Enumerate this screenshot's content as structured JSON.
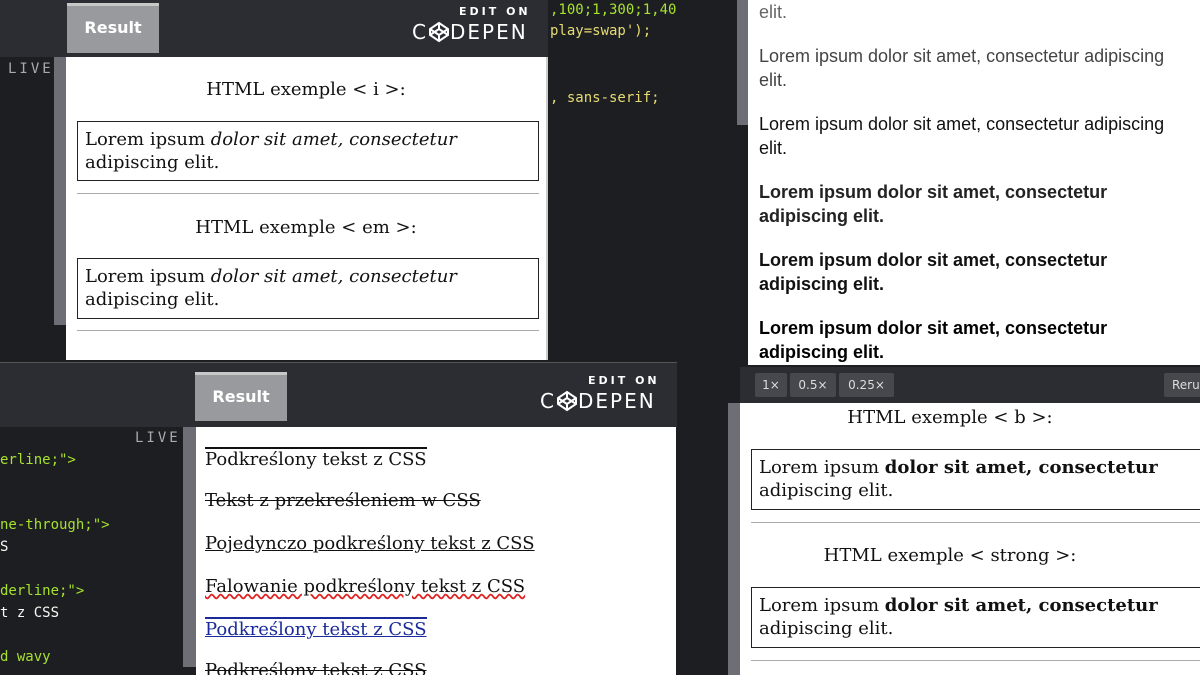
{
  "panel_top_left": {
    "result_tab": "Result",
    "edit_on": "EDIT ON",
    "codepen": "C DEPEN",
    "live": "LIVE",
    "heading_i": "HTML exemple < i >:",
    "box_i": {
      "before": "Lorem ipsum ",
      "emph": "dolor sit amet, consectetur",
      "after": " adipiscing elit."
    },
    "heading_em": "HTML exemple < em >:",
    "box_em": {
      "before": "Lorem ipsum ",
      "emph": "dolor sit amet, consectetur",
      "after": " adipiscing elit."
    }
  },
  "panel_top_middle": {
    "code_line1": ",100;1,300;1,40",
    "code_line2": "play=swap');",
    "code_line3": ", sans-serif;"
  },
  "panel_top_right": {
    "cut_text": "elit.",
    "para1": "Lorem ipsum dolor sit amet, consectetur adipiscing elit.",
    "para2": "Lorem ipsum dolor sit amet, consectetur adipiscing elit.",
    "para3": "Lorem ipsum dolor sit amet, consectetur adipiscing elit.",
    "para4": "Lorem ipsum dolor sit amet, consectetur adipiscing elit.",
    "para5": "Lorem ipsum dolor sit amet, consectetur adipiscing elit."
  },
  "panel_bottom_left": {
    "result_tab": "Result",
    "edit_on": "EDIT ON",
    "codepen": "C DEPEN",
    "live": "LIVE",
    "code_lines": [
      "erline;\">",
      "",
      "",
      "ne-through;\">",
      "S",
      "",
      "derline;\">",
      "t z CSS",
      "",
      "d wavy"
    ],
    "items": [
      "Podkreślony tekst z CSS",
      "Tekst z przekreśleniem w CSS",
      "Pojedynczo podkreślony tekst z CSS",
      "Falowanie podkreślony tekst z CSS",
      "Podkreślony tekst z CSS",
      "Podkreślony tekst z CSS"
    ]
  },
  "panel_bottom_right": {
    "zoom": [
      "1×",
      "0.5×",
      "0.25×"
    ],
    "rerun": "Rerun",
    "heading_b": "HTML exemple < b >:",
    "box_b": {
      "before": "Lorem ipsum ",
      "bold": "dolor sit amet, consectetur",
      "after": " adipiscing elit."
    },
    "heading_strong": "HTML exemple < strong >:",
    "box_strong": {
      "before": "Lorem ipsum ",
      "bold": "dolor sit amet, consectetur",
      "after": " adipiscing elit."
    }
  },
  "colors": {
    "editor_bg": "#1d1e22",
    "header_bg": "#2c2d32",
    "wavy": "#e02020",
    "blue_underline": "#1a2a9a"
  }
}
